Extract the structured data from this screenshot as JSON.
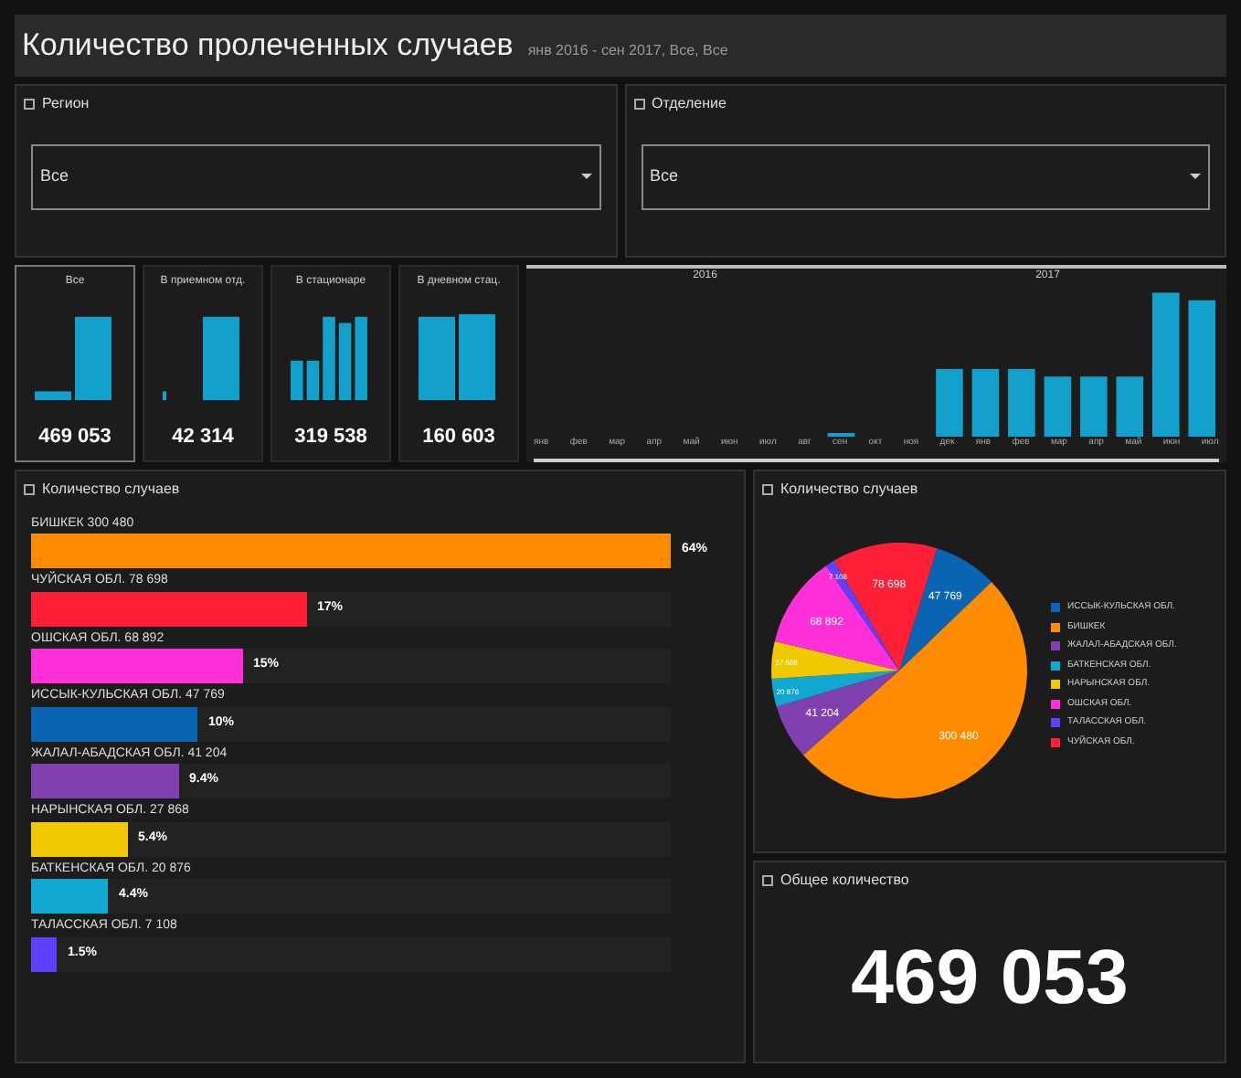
{
  "header": {
    "title": "Количество пролеченных случаев",
    "subtitle": "янв 2016 - сен 2017, Все, Все"
  },
  "filters": [
    {
      "label": "Регион",
      "value": "Все"
    },
    {
      "label": "Отделение",
      "value": "Все"
    }
  ],
  "kpis": [
    {
      "label": "Все",
      "value": "469 053",
      "selected": true
    },
    {
      "label": "В приемном отд.",
      "value": "42 314",
      "selected": false
    },
    {
      "label": "В стационаре",
      "value": "319 538",
      "selected": false
    },
    {
      "label": "В дневном стац.",
      "value": "160 603",
      "selected": false
    }
  ],
  "timeline": {
    "years": [
      "2016",
      "2017"
    ],
    "months": [
      "янв",
      "фев",
      "мар",
      "апр",
      "май",
      "июн",
      "июл",
      "авг",
      "сен",
      "окт",
      "ноя",
      "дек",
      "янв",
      "фев",
      "мар",
      "апр",
      "май",
      "июн",
      "июл"
    ]
  },
  "bar_panel": {
    "title": "Количество случаев",
    "rows": [
      {
        "label": "БИШКЕК 300 480",
        "percent": "64%",
        "level": 1,
        "color": "#ff8c00"
      },
      {
        "label": "ЧУЙСКАЯ ОБЛ. 78 698",
        "percent": "17%",
        "level": 0.43,
        "color": "#ff2038"
      },
      {
        "label": "ОШСКАЯ ОБЛ. 68 892",
        "percent": "15%",
        "level": 0.33,
        "color": "#ff30d8"
      },
      {
        "label": "ИССЫК-КУЛЬСКАЯ ОБЛ. 47 769",
        "percent": "10%",
        "level": 0.26,
        "color": "#0a64b4"
      },
      {
        "label": "ЖАЛАЛ-АБАДСКАЯ ОБЛ. 41 204",
        "percent": "9.4%",
        "level": 0.23,
        "color": "#8040b0"
      },
      {
        "label": "НАРЫНСКАЯ ОБЛ. 27 868",
        "percent": "5.4%",
        "level": 0.15,
        "color": "#f0c800"
      },
      {
        "label": "БАТКЕНСКАЯ ОБЛ. 20 876",
        "percent": "4.4%",
        "level": 0.12,
        "color": "#10a8d0"
      },
      {
        "label": "ТАЛАССКАЯ ОБЛ. 7 108",
        "percent": "1.5%",
        "level": 0.04,
        "color": "#6040ff"
      }
    ]
  },
  "pie_panel": {
    "title": "Количество случаев",
    "chart_data": {
      "type": "pie",
      "data_labels": true,
      "categories": [
        "ИССЫК-КУЛЬСКАЯ ОБЛ.",
        "БИШКЕК",
        "ЖАЛАЛ-АБАДСКАЯ ОБЛ.",
        "БАТКЕНСКАЯ ОБЛ.",
        "НАРЫНСКАЯ ОБЛ.",
        "ОШСКАЯ ОБЛ.",
        "ТАЛАССКАЯ ОБЛ.",
        "ЧУЙСКАЯ ОБЛ."
      ],
      "series": [
        {
          "values": [
            47769,
            300480,
            41204,
            20876,
            27868,
            68892,
            7108,
            78698
          ],
          "colors": [
            "#0a64b4",
            "#ff8c00",
            "#8040b0",
            "#10a8d0",
            "#f0c800",
            "#ff30d8",
            "#6040ff",
            "#ff2038"
          ]
        }
      ]
    }
  },
  "total_panel": {
    "title": "Общее количество",
    "value": "469 053"
  }
}
